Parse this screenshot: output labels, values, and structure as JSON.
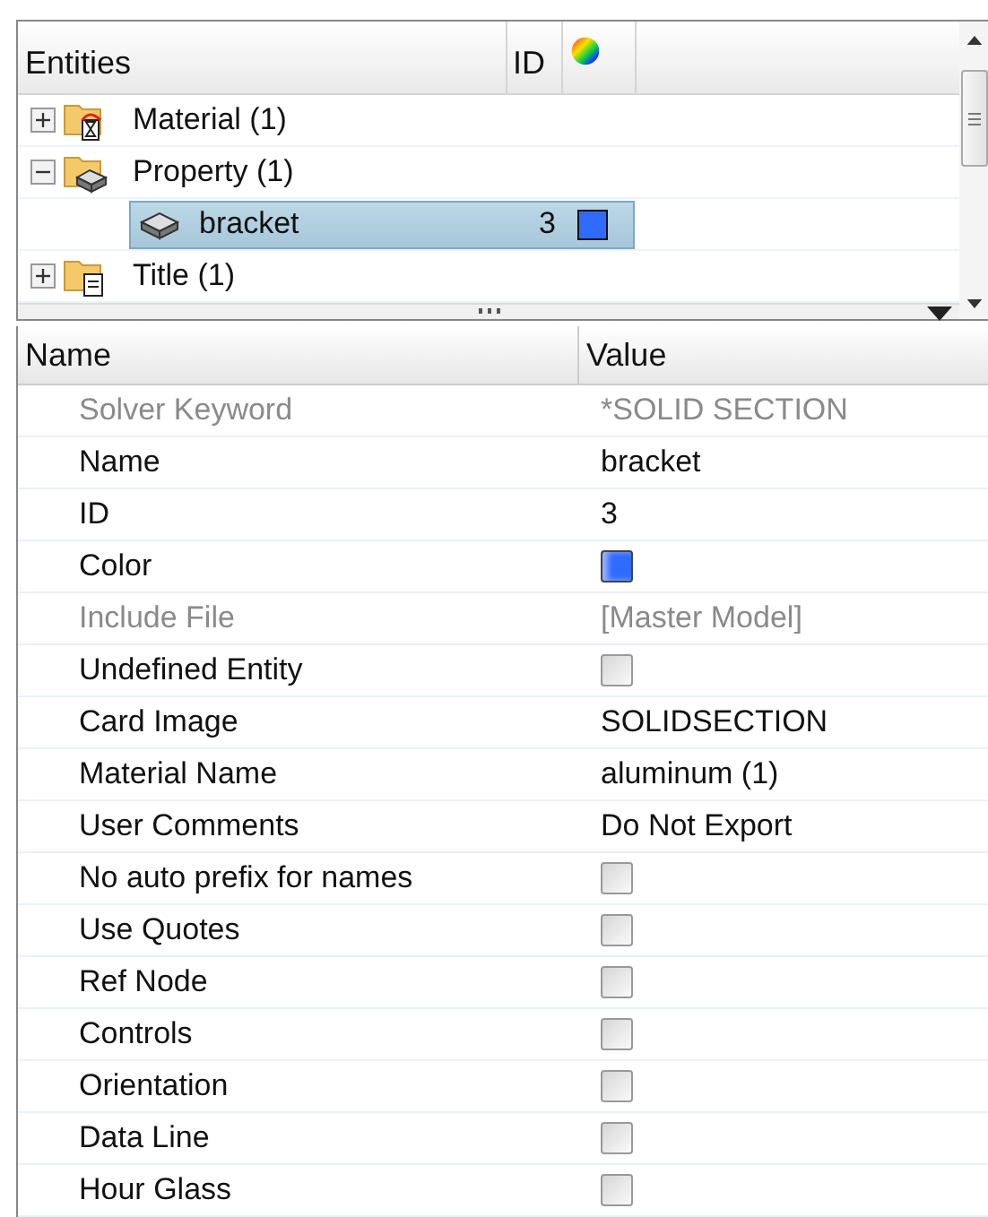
{
  "entity_tree": {
    "columns": [
      "Entities",
      "ID"
    ],
    "items": [
      {
        "label": "Material (1)",
        "kind": "material",
        "expanded": false
      },
      {
        "label": "Property (1)",
        "kind": "property",
        "expanded": true,
        "children": [
          {
            "label": "bracket",
            "id": "3",
            "color": "#2f6bff",
            "selected": true
          }
        ]
      },
      {
        "label": "Title (1)",
        "kind": "title",
        "expanded": false
      }
    ]
  },
  "property_table": {
    "columns": [
      "Name",
      "Value"
    ],
    "rows": [
      {
        "name": "Solver Keyword",
        "kind": "text",
        "value": "*SOLID SECTION",
        "disabled": true
      },
      {
        "name": "Name",
        "kind": "text",
        "value": "bracket",
        "disabled": false
      },
      {
        "name": "ID",
        "kind": "text",
        "value": "3",
        "disabled": false
      },
      {
        "name": "Color",
        "kind": "color",
        "color": "#2f6bff",
        "disabled": false
      },
      {
        "name": "Include File",
        "kind": "text",
        "value": "[Master Model]",
        "disabled": true
      },
      {
        "name": "Undefined Entity",
        "kind": "checkbox",
        "checked": false,
        "disabled": false
      },
      {
        "name": "Card Image",
        "kind": "text",
        "value": "SOLIDSECTION",
        "disabled": false
      },
      {
        "name": "Material Name",
        "kind": "text",
        "value": "aluminum (1)",
        "disabled": false
      },
      {
        "name": "User Comments",
        "kind": "text",
        "value": "Do Not Export",
        "disabled": false
      },
      {
        "name": "No auto prefix for names",
        "kind": "checkbox",
        "checked": false,
        "disabled": false
      },
      {
        "name": "Use Quotes",
        "kind": "checkbox",
        "checked": false,
        "disabled": false
      },
      {
        "name": "Ref Node",
        "kind": "checkbox",
        "checked": false,
        "disabled": false
      },
      {
        "name": "Controls",
        "kind": "checkbox",
        "checked": false,
        "disabled": false
      },
      {
        "name": "Orientation",
        "kind": "checkbox",
        "checked": false,
        "disabled": false
      },
      {
        "name": "Data Line",
        "kind": "checkbox",
        "checked": false,
        "disabled": false
      },
      {
        "name": "Hour Glass",
        "kind": "checkbox",
        "checked": false,
        "disabled": false
      }
    ]
  }
}
